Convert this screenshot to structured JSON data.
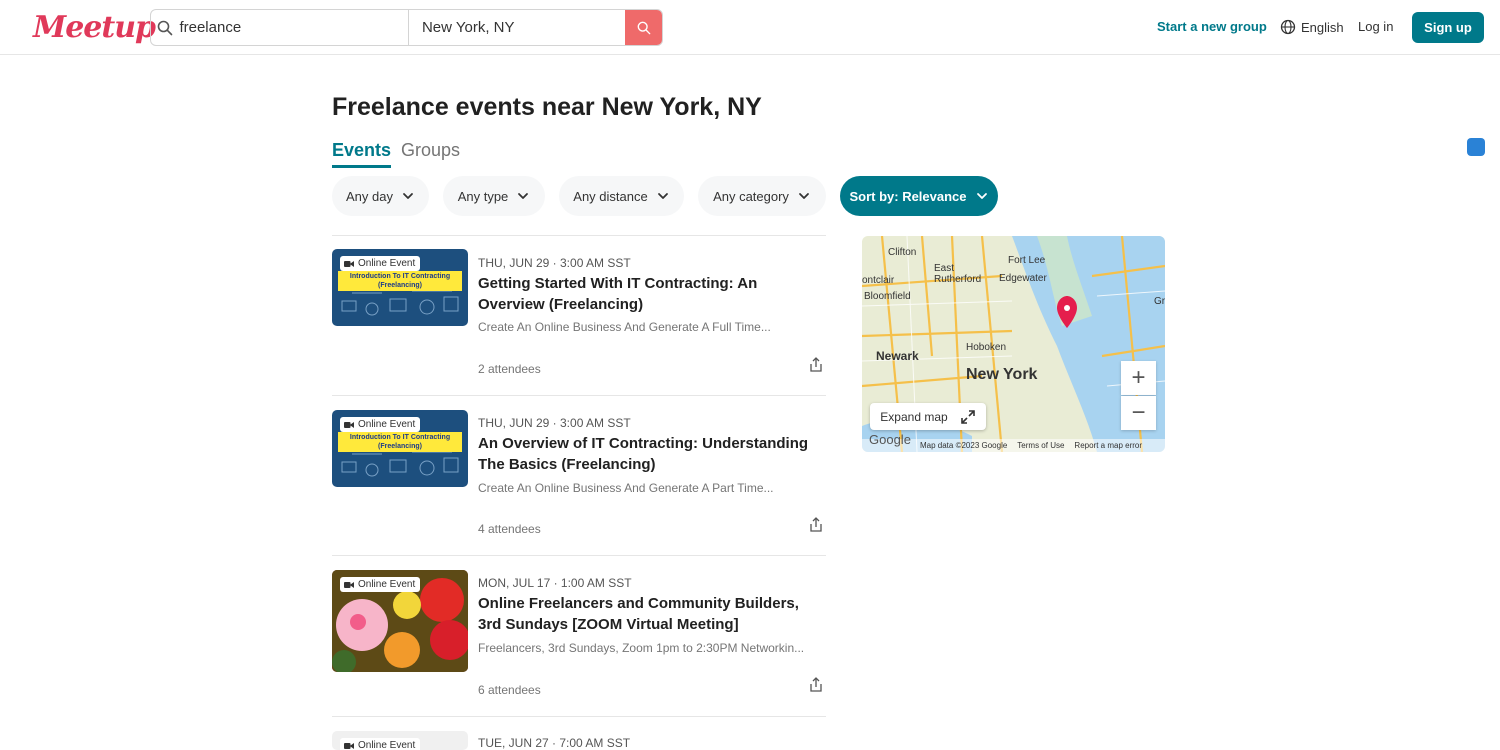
{
  "app": {
    "logo": "Meetup"
  },
  "search": {
    "keyword": "freelance",
    "location": "New York, NY"
  },
  "nav": {
    "start_group": "Start a new group",
    "language": "English",
    "login": "Log in",
    "signup": "Sign up"
  },
  "page": {
    "title": "Freelance events near New York, NY"
  },
  "tabs": [
    {
      "label": "Events"
    },
    {
      "label": "Groups"
    }
  ],
  "filters": [
    {
      "label": "Any day"
    },
    {
      "label": "Any type"
    },
    {
      "label": "Any distance"
    },
    {
      "label": "Any category"
    },
    {
      "label": "Sort by: Relevance"
    }
  ],
  "events": [
    {
      "badge": "Online Event",
      "thumb_text": "Introduction To IT Contracting (Freelancing)",
      "date": "THU, JUN 29 · 3:00 AM SST",
      "title": "Getting Started With IT Contracting: An Overview (Freelancing)",
      "desc": "Create An Online Business And Generate A Full Time...",
      "attendees": "2 attendees"
    },
    {
      "badge": "Online Event",
      "thumb_text": "Introduction To IT Contracting (Freelancing)",
      "date": "THU, JUN 29 · 3:00 AM SST",
      "title": "An Overview of IT Contracting: Understanding The Basics (Freelancing)",
      "desc": "Create An Online Business And Generate A Part Time...",
      "attendees": "4 attendees"
    },
    {
      "badge": "Online Event",
      "date": "MON, JUL 17 · 1:00 AM SST",
      "title": "Online Freelancers and Community Builders, 3rd Sundays [ZOOM Virtual Meeting]",
      "desc": "Freelancers, 3rd Sundays, Zoom 1pm to 2:30PM Networkin...",
      "attendees": "6 attendees"
    },
    {
      "badge": "Online Event",
      "date": "TUE, JUN 27 · 7:00 AM SST"
    }
  ],
  "map": {
    "labels": [
      "Clifton",
      "East Rutherford",
      "Fort Lee",
      "Edgewater",
      "ontclair",
      "Bloomfield",
      "Newark",
      "Hoboken",
      "Gr"
    ],
    "city": "New York",
    "expand": "Expand map",
    "google": "Google",
    "footer": [
      "Map data ©2023 Google",
      "Terms of Use",
      "Report a map error"
    ],
    "zoom_in": "+",
    "zoom_out": "−"
  },
  "colors": {
    "accent": "#00798a",
    "brand": "#e0395a",
    "search_button": "#ef6a6a"
  }
}
